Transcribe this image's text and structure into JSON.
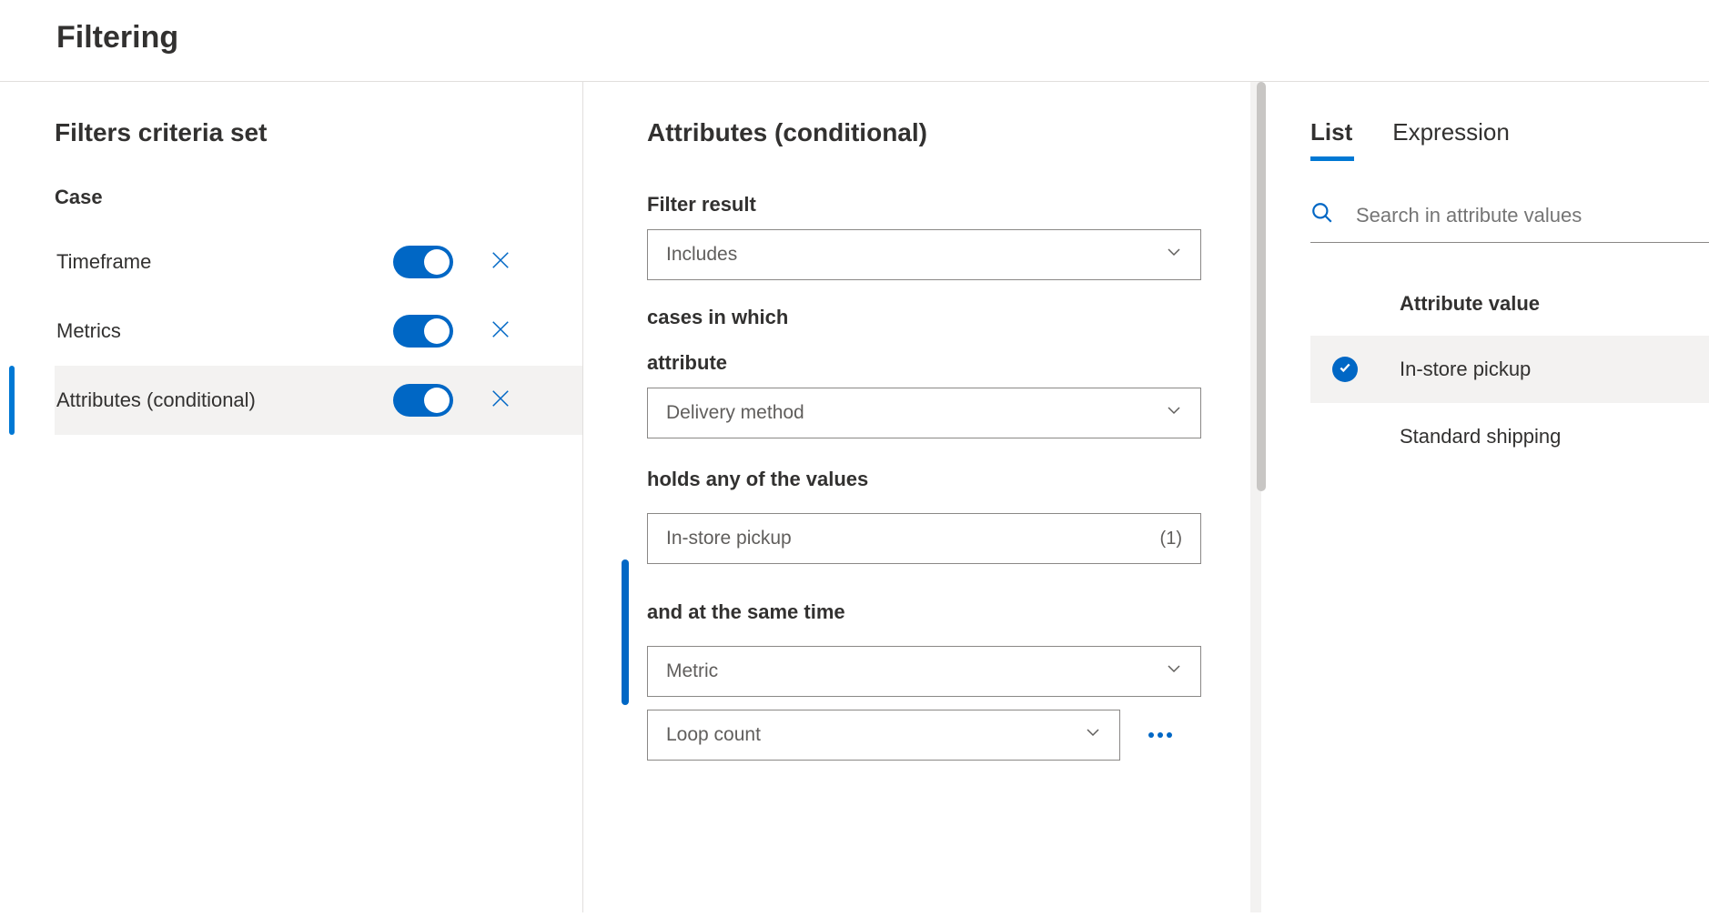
{
  "header": {
    "title": "Filtering"
  },
  "left": {
    "section_title": "Filters criteria set",
    "group_label": "Case",
    "items": [
      {
        "label": "Timeframe",
        "enabled": true,
        "selected": false
      },
      {
        "label": "Metrics",
        "enabled": true,
        "selected": false
      },
      {
        "label": "Attributes (conditional)",
        "enabled": true,
        "selected": true
      }
    ]
  },
  "mid": {
    "panel_title": "Attributes (conditional)",
    "filter_result_label": "Filter result",
    "filter_result_value": "Includes",
    "cases_label": "cases in which",
    "attribute_label": "attribute",
    "attribute_value": "Delivery method",
    "holds_label": "holds any of the values",
    "holds_value": "In-store pickup",
    "holds_count": "(1)",
    "and_label": "and at the same time",
    "metric_category_value": "Metric",
    "metric_value": "Loop count"
  },
  "right": {
    "tabs": {
      "list": "List",
      "expression": "Expression"
    },
    "search_placeholder": "Search in attribute values",
    "attr_header": "Attribute value",
    "values": [
      {
        "label": "In-store pickup",
        "checked": true
      },
      {
        "label": "Standard shipping",
        "checked": false
      }
    ]
  }
}
